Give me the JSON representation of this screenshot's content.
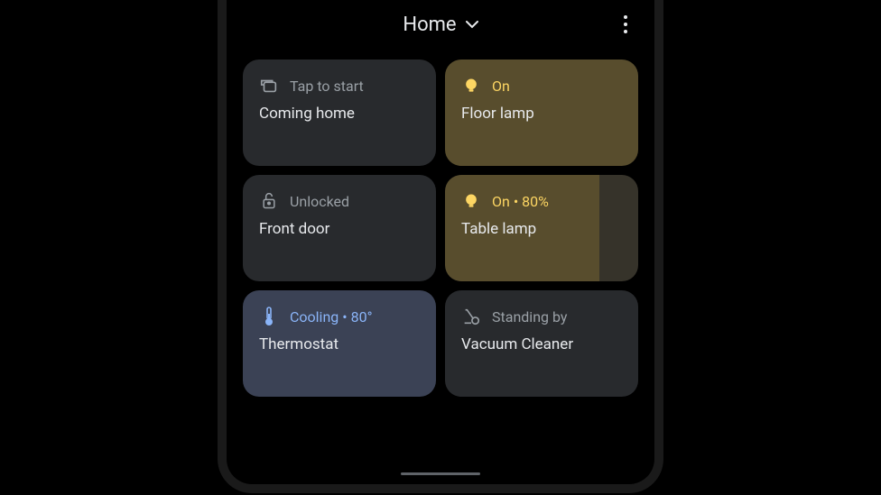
{
  "header": {
    "title": "Home"
  },
  "tiles": [
    {
      "status": "Tap to start",
      "name": "Coming home"
    },
    {
      "status": "On",
      "name": "Floor lamp"
    },
    {
      "status": "Unlocked",
      "name": "Front door"
    },
    {
      "status": "On • 80%",
      "name": "Table lamp",
      "fill_percent": 80
    },
    {
      "status": "Cooling • 80°",
      "name": "Thermostat"
    },
    {
      "status": "Standing by",
      "name": "Vacuum Cleaner"
    }
  ],
  "colors": {
    "yellow_accent": "#fdd663",
    "blue_accent": "#8ab4f8",
    "grey_text": "#9aa0a6"
  }
}
